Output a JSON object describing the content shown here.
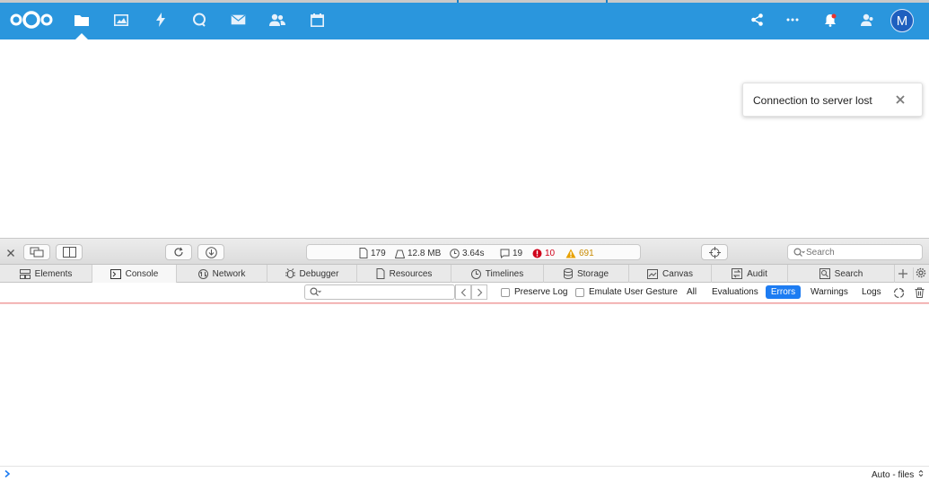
{
  "header": {
    "background": "#2a96dd",
    "logo": "nextcloud-logo",
    "nav_icons": [
      "folder-icon",
      "image-icon",
      "lightning-icon",
      "chat-icon",
      "mail-icon",
      "contacts-icon",
      "calendar-icon"
    ],
    "right_icons": [
      "share-icon",
      "more-icon",
      "bell-icon",
      "contacts-menu-icon"
    ],
    "avatar_letter": "M"
  },
  "toast": {
    "message": "Connection to server lost"
  },
  "devtools": {
    "toolbar": {
      "resources_count": "179",
      "size": "12.8 MB",
      "time": "3.64s",
      "logs": "19",
      "errors": "10",
      "warnings": "691",
      "error_color": "#d0021b",
      "warning_color": "#e8a100",
      "search_placeholder": "Search"
    },
    "tabs": [
      {
        "label": "Elements",
        "icon": "elements-icon"
      },
      {
        "label": "Console",
        "icon": "console-icon",
        "active": true
      },
      {
        "label": "Network",
        "icon": "network-icon"
      },
      {
        "label": "Debugger",
        "icon": "debugger-icon"
      },
      {
        "label": "Resources",
        "icon": "resources-icon"
      },
      {
        "label": "Timelines",
        "icon": "timelines-icon"
      },
      {
        "label": "Storage",
        "icon": "storage-icon"
      },
      {
        "label": "Canvas",
        "icon": "canvas-icon"
      },
      {
        "label": "Audit",
        "icon": "audit-icon"
      },
      {
        "label": "Search",
        "icon": "search-tab-icon"
      }
    ],
    "console_filter": {
      "placeholder": "",
      "preserve_log": "Preserve Log",
      "emulate_gesture": "Emulate User Gesture",
      "levels": [
        "All",
        "Evaluations",
        "Errors",
        "Warnings",
        "Logs"
      ],
      "active_level": "Errors",
      "accent": "#1d7cf2"
    },
    "bottom": {
      "context": "Auto - files"
    }
  }
}
